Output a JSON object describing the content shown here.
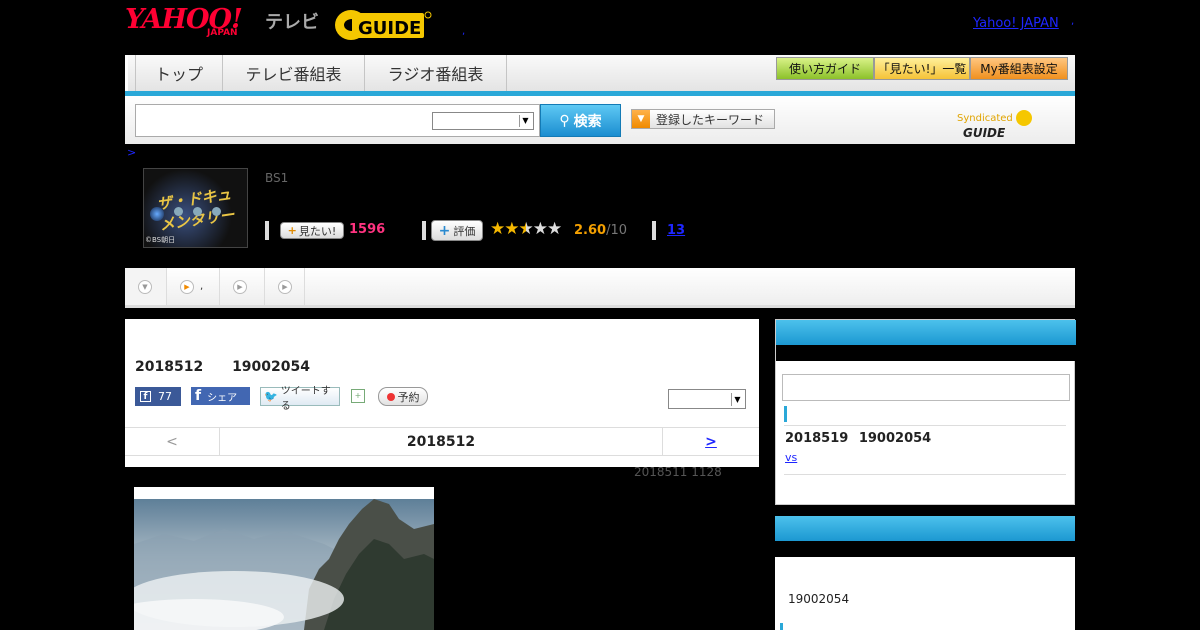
{
  "header": {
    "logo_main": "YAHOO!",
    "logo_sub": "JAPAN",
    "service": "テレビ",
    "gguide_logo": "GUIDE",
    "yahoo_japan_link": "Yahoo! JAPAN",
    "dot_left": ",",
    "dot_right": ","
  },
  "nav": {
    "tabs": [
      {
        "label": "トップ"
      },
      {
        "label": "テレビ番組表"
      },
      {
        "label": "ラジオ番組表"
      }
    ],
    "buttons": [
      {
        "label": "使い方ガイド"
      },
      {
        "label": "「見たい!」一覧"
      },
      {
        "label": "My番組表設定"
      }
    ]
  },
  "search": {
    "input_value": "",
    "select_value": "",
    "button_label": "検索",
    "keyword_button_label": "登録したキーワード",
    "syndicated_label": "Syndicated",
    "syndicated_logo": "GUIDE"
  },
  "breadcrumb": ">",
  "program": {
    "thumb_caption": "©BS朝日",
    "thumb_title": "ザ・ドキュメンタリー",
    "channel": "BS1",
    "mitai_label": "見たい!",
    "mitai_count": "1596",
    "hyoka_label": "評価",
    "rating": "2.60",
    "rating_max": "/10",
    "rating_fraction": 0.26,
    "comment_count": "13"
  },
  "subtabs": [
    {
      "label": ""
    },
    {
      "label": ","
    },
    {
      "label": ""
    },
    {
      "label": ""
    }
  ],
  "main": {
    "title": "2018512 19002054",
    "fb_count": "77",
    "share_label": "シェア",
    "tweet_label": "ツイートする",
    "reserve_label": "予約",
    "select_value": "",
    "pager_prev": "<",
    "pager_current": "2018512",
    "pager_next": ">",
    "updated": "2018511  1128"
  },
  "sidebar": {
    "box1": {
      "input_value": "",
      "item_title": "2018519 19002054",
      "item_link": "vs "
    },
    "box2": {
      "item_title": "19002054"
    }
  },
  "colors": {
    "accent": "#2aa8d8",
    "link": "#1e26ff",
    "mitai": "#ff3380",
    "rating": "#f5a000",
    "logo": "#ff0033"
  }
}
